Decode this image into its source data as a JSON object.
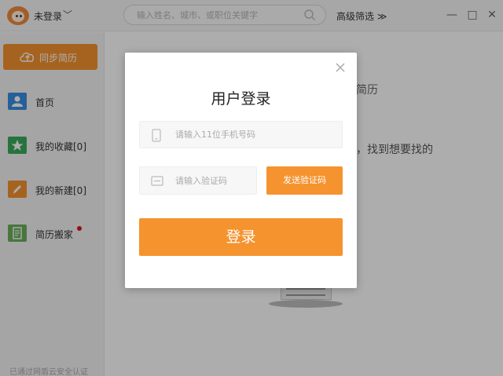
{
  "header": {
    "user_label": "未登录",
    "user_chevron": "﹀",
    "search": {
      "placeholder": "输入姓名、城市、或职位关键字",
      "value": ""
    },
    "advanced_filter_label": "高级筛选 ≫",
    "window_controls": {
      "minimize": "—",
      "maximize": "□",
      "close": "✕"
    }
  },
  "sidebar": {
    "sync_button_label": "同步简历",
    "items": [
      {
        "label": "首页",
        "icon": "person-icon",
        "color": "#3a8ee0"
      },
      {
        "label": "我的收藏[0]",
        "icon": "star-icon",
        "color": "#3aaa5a"
      },
      {
        "label": "我的新建[0]",
        "icon": "pencil-icon",
        "color": "#f5932f"
      },
      {
        "label": "简历搬家",
        "icon": "document-icon",
        "color": "#6aae5a"
      }
    ],
    "footer_note": "已通过网盾云安全认证"
  },
  "main": {
    "text_line1": "简历",
    "text_line2": "，找到想要找的"
  },
  "login_modal": {
    "title": "用户登录",
    "phone": {
      "placeholder": "请输入11位手机号码",
      "value": ""
    },
    "code": {
      "placeholder": "请输入验证码",
      "value": ""
    },
    "send_code_label": "发送验证码",
    "login_label": "登录",
    "close_icon": "close-icon"
  },
  "colors": {
    "accent": "#f5932f",
    "overlay": "rgba(0,0,0,0.32)",
    "notification_dot": "#d9141c"
  }
}
